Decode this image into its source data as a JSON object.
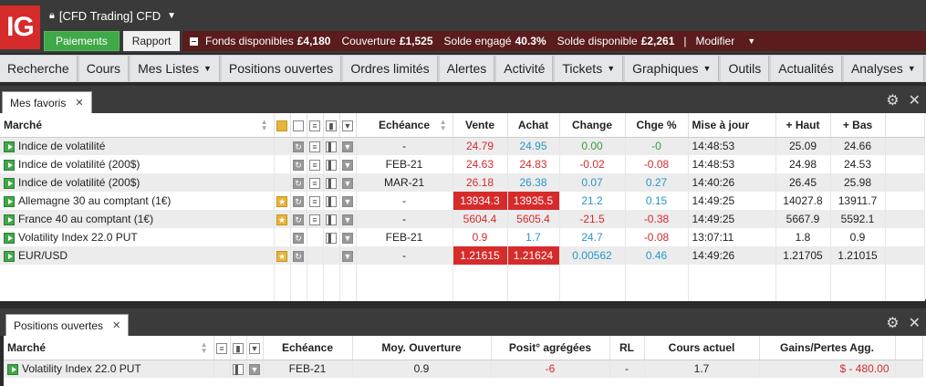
{
  "app": {
    "logo": "IG",
    "account_label": "[CFD Trading] CFD"
  },
  "topbar": {
    "paiements": "Paiements",
    "rapport": "Rapport",
    "funds_label": "Fonds disponibles",
    "funds_value": "£4,180",
    "couverture_label": "Couverture",
    "couverture_value": "£1,525",
    "solde_engage_label": "Solde engagé",
    "solde_engage_value": "40.3%",
    "solde_dispo_label": "Solde disponible",
    "solde_dispo_value": "£2,261",
    "separator": "|",
    "modifier": "Modifier"
  },
  "nav": {
    "items": [
      {
        "label": "Recherche",
        "dropdown": false
      },
      {
        "label": "Cours",
        "dropdown": false
      },
      {
        "label": "Mes Listes",
        "dropdown": true
      },
      {
        "label": "Positions ouvertes",
        "dropdown": false
      },
      {
        "label": "Ordres limités",
        "dropdown": false
      },
      {
        "label": "Alertes",
        "dropdown": false
      },
      {
        "label": "Activité",
        "dropdown": false
      },
      {
        "label": "Tickets",
        "dropdown": true
      },
      {
        "label": "Graphiques",
        "dropdown": true
      },
      {
        "label": "Outils",
        "dropdown": false
      },
      {
        "label": "Actualités",
        "dropdown": false
      },
      {
        "label": "Analyses",
        "dropdown": true
      }
    ]
  },
  "favoris": {
    "tab": "Mes favoris",
    "columns": {
      "marche": "Marché",
      "echeance": "Echéance",
      "vente": "Vente",
      "achat": "Achat",
      "change": "Change",
      "chge_pct": "Chge %",
      "mise": "Mise à jour",
      "haut": "+ Haut",
      "bas": "+ Bas"
    },
    "rows": [
      {
        "marche": "Indice de volatilité",
        "bulb": false,
        "echeance": "-",
        "vente": "24.79",
        "achat": "24.95",
        "change": "0.00",
        "chge": "-0",
        "mise": "14:48:53",
        "haut": "25.09",
        "bas": "24.66",
        "dir": "up",
        "hl": false
      },
      {
        "marche": "Indice de volatilité (200$)",
        "bulb": false,
        "echeance": "FEB-21",
        "vente": "24.63",
        "achat": "24.83",
        "change": "-0.02",
        "chge": "-0.08",
        "mise": "14:48:53",
        "haut": "24.98",
        "bas": "24.53",
        "dir": "down",
        "hl": false
      },
      {
        "marche": "Indice de volatilité (200$)",
        "bulb": false,
        "echeance": "MAR-21",
        "vente": "26.18",
        "achat": "26.38",
        "change": "0.07",
        "chge": "0.27",
        "mise": "14:40:26",
        "haut": "26.45",
        "bas": "25.98",
        "dir": "blue",
        "hl": false
      },
      {
        "marche": "Allemagne 30 au comptant (1€)",
        "bulb": true,
        "echeance": "-",
        "vente": "13934.3",
        "achat": "13935.5",
        "change": "21.2",
        "chge": "0.15",
        "mise": "14:49:25",
        "haut": "14027.8",
        "bas": "13911.7",
        "dir": "blue",
        "hl": true
      },
      {
        "marche": "France 40 au comptant (1€)",
        "bulb": true,
        "echeance": "-",
        "vente": "5604.4",
        "achat": "5605.4",
        "change": "-21.5",
        "chge": "-0.38",
        "mise": "14:49:25",
        "haut": "5667.9",
        "bas": "5592.1",
        "dir": "down",
        "hl": false
      },
      {
        "marche": "Volatility Index 22.0 PUT",
        "bulb": false,
        "echeance": "FEB-21",
        "vente": "0.9",
        "achat": "1.7",
        "change": "24.7",
        "chge": "-0.08",
        "mise": "13:07:11",
        "haut": "1.8",
        "bas": "0.9",
        "dir": "mixed",
        "hl": false
      },
      {
        "marche": "EUR/USD",
        "bulb": true,
        "echeance": "-",
        "vente": "1.21615",
        "achat": "1.21624",
        "change": "0.00562",
        "chge": "0.46",
        "mise": "14:49:26",
        "haut": "1.21705",
        "bas": "1.21015",
        "dir": "blue",
        "hl": true
      }
    ]
  },
  "positions": {
    "tab": "Positions ouvertes",
    "columns": {
      "marche": "Marché",
      "echeance": "Echéance",
      "moy": "Moy. Ouverture",
      "posit": "Posit° agrégées",
      "rl": "RL",
      "cours": "Cours actuel",
      "gains": "Gains/Pertes Agg."
    },
    "rows": [
      {
        "marche": "Volatility Index 22.0 PUT",
        "echeance": "FEB-21",
        "moy": "0.9",
        "posit": "-6",
        "rl": "-",
        "cours": "1.7",
        "gains": "$ - 480.00"
      }
    ]
  }
}
